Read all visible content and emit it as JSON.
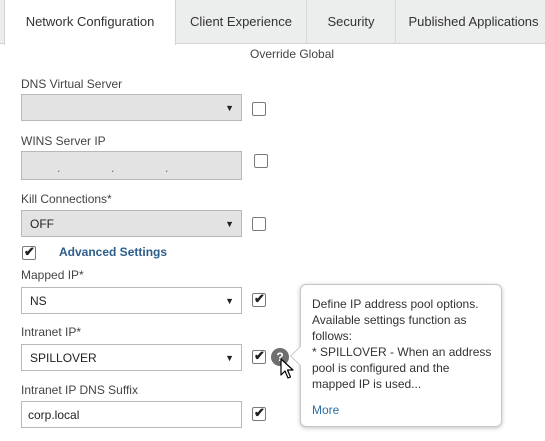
{
  "tabs": [
    {
      "label": "Network Configuration",
      "active": true
    },
    {
      "label": "Client Experience",
      "active": false
    },
    {
      "label": "Security",
      "active": false
    },
    {
      "label": "Published Applications",
      "active": false
    }
  ],
  "override_header": "Override Global",
  "fields": {
    "dns_virtual_server": {
      "label": "DNS Virtual Server",
      "value": "",
      "disabled": true,
      "override_checked": false
    },
    "wins_server_ip": {
      "label": "WINS Server IP",
      "separator": ".",
      "disabled": true,
      "override_checked": false
    },
    "kill_connections": {
      "label": "Kill Connections*",
      "value": "OFF",
      "disabled": true,
      "override_checked": false
    },
    "advanced_settings": {
      "label": "Advanced Settings",
      "checked": true
    },
    "mapped_ip": {
      "label": "Mapped IP*",
      "value": "NS",
      "override_checked": true
    },
    "intranet_ip": {
      "label": "Intranet IP*",
      "value": "SPILLOVER",
      "override_checked": true
    },
    "intranet_ip_dns_suffix": {
      "label": "Intranet IP DNS Suffix",
      "value": "corp.local",
      "override_checked": true
    }
  },
  "icons": {
    "caret": "▼",
    "check": "✔",
    "help": "?"
  },
  "popover": {
    "lines": [
      "Define IP address pool options.",
      "Available settings function as",
      "follows:",
      "* SPILLOVER - When an address",
      "pool is configured and the",
      "mapped IP is used..."
    ],
    "more_link": "More"
  },
  "colors": {
    "accent": "#2d5e8a",
    "link": "#2d6ea6",
    "tab_bar": "#eceded",
    "disabled_field": "#e3e3e3"
  }
}
